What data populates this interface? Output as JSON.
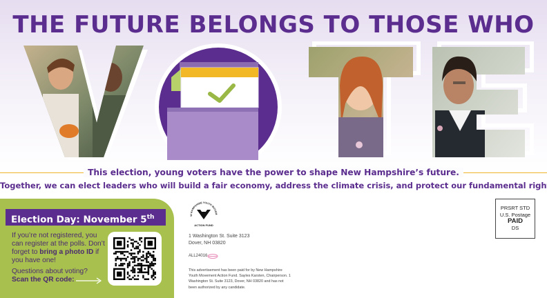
{
  "headline": "THE FUTURE BELONGS TO THOSE WHO",
  "tagline_1": "This election, young voters have the power to shape New Hampshire’s future.",
  "tagline_2": "Together, we can elect leaders who will build a fair economy, address the climate crisis, and protect our fundamental rights.",
  "election_day": {
    "label": "Election Day: November 5",
    "suffix": "th"
  },
  "registration": {
    "line_1": "If you’re not registered, you can register at the polls. Don’t forget to ",
    "bold": "bring a photo ID",
    "line_2": " if you have one!"
  },
  "questions": {
    "line_1": "Questions about voting?",
    "bold": "Scan the QR code:"
  },
  "logo": {
    "arc_text": "NEW HAMPSHIRE YOUTH MOVEMENT",
    "bottom_text": "ACTION FUND"
  },
  "address": {
    "line_1": "1 Washington St. Suite 3123",
    "line_2": "Dover, NH 03820"
  },
  "mail_code": "ALL24016",
  "disclaimer": "This advertisement has been paid for by New Hampshire Youth Movement Action Fund. Sayles Karsten, Chairperson. 1 Washington St. Suite 3123, Dover, NH 03820 and has not been authorized by any candidate.",
  "indicia": {
    "line_1": "PRSRT STD",
    "line_2": "U.S. Postage",
    "line_3": "PAID",
    "line_4": "DS"
  },
  "colors": {
    "purple": "#5b2d8e",
    "gold": "#f0b428",
    "green": "#a8c04e",
    "lavender": "#e6ddf0"
  }
}
